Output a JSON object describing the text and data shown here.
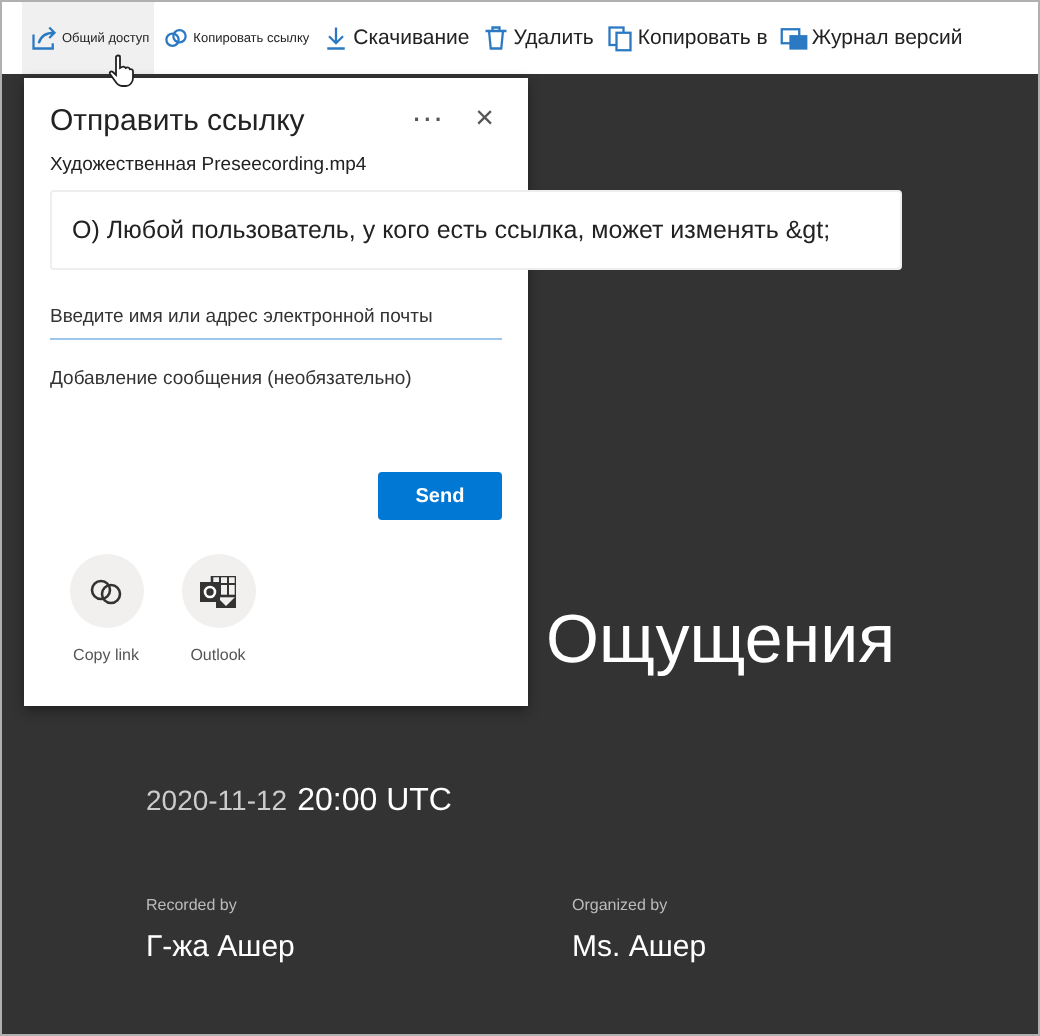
{
  "toolbar": {
    "items": [
      {
        "label": "Общий доступ",
        "kind": "small",
        "selected": true
      },
      {
        "label": "Копировать ссылку",
        "kind": "small",
        "selected": false
      },
      {
        "label": "Скачивание",
        "kind": "regular",
        "selected": false
      },
      {
        "label": "Удалить",
        "kind": "regular",
        "selected": false
      },
      {
        "label": "Копировать в",
        "kind": "regular",
        "selected": false
      },
      {
        "label": "Журнал версий",
        "kind": "regular",
        "selected": false
      }
    ]
  },
  "dialog": {
    "title": "Отправить ссылку",
    "more": "···",
    "close": "×",
    "file_name": "Художественная Preseecording.mp4",
    "permission": "О) Любой пользователь, у кого есть ссылка, может изменять &gt;",
    "recipient": {
      "placeholder": "Введите имя или адрес электронной почты"
    },
    "message": {
      "placeholder": "Добавление сообщения (необязательно)"
    },
    "send": "Send",
    "share_options": [
      {
        "label": "Copy link"
      },
      {
        "label": "Outlook"
      }
    ]
  },
  "video": {
    "title": "Ощущения",
    "date": "2020-11-12",
    "time": "20:00 UTC",
    "people": [
      {
        "label": "Recorded by",
        "name": "Г-жа Ашер"
      },
      {
        "label": "Organized by",
        "name": "Ms. Ашер"
      }
    ]
  }
}
